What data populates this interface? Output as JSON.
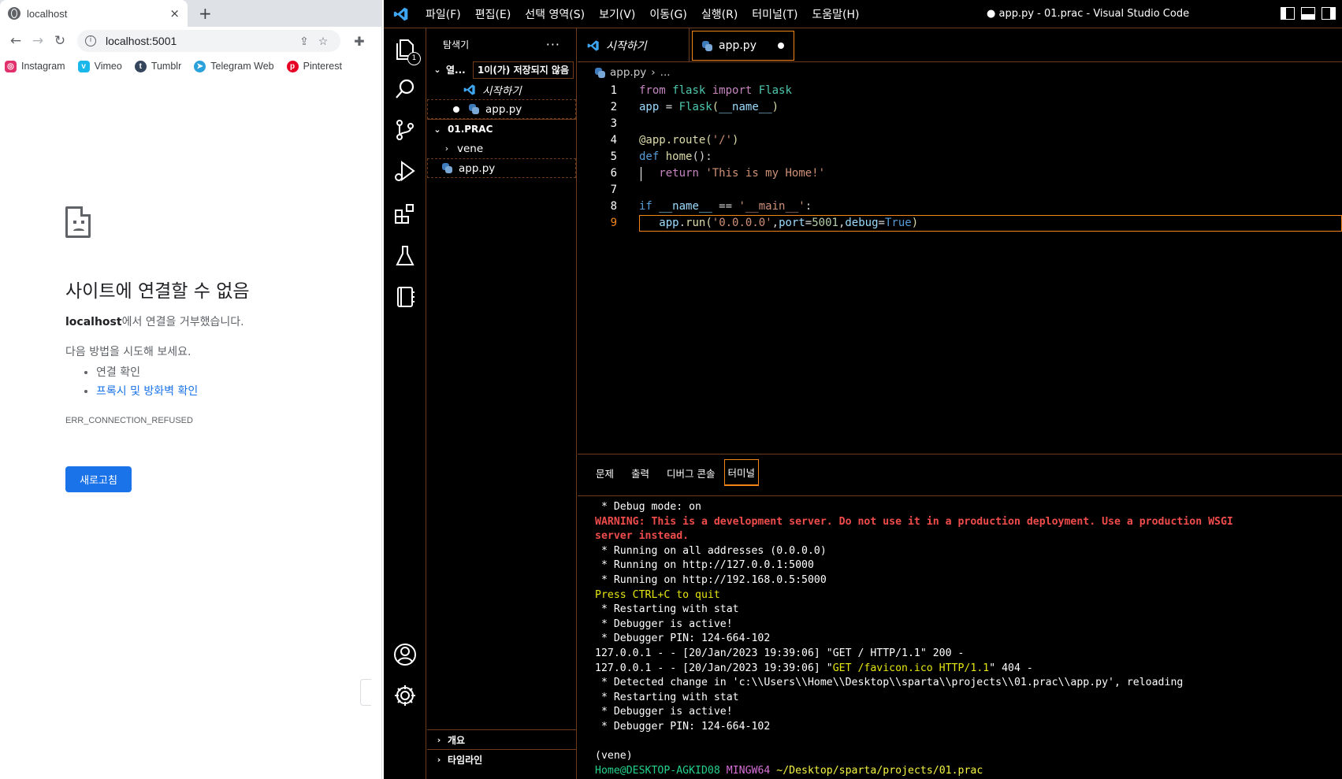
{
  "chrome": {
    "tab": {
      "title": "localhost",
      "close": "×"
    },
    "new_tab": "+",
    "omnibox": {
      "url": "localhost:5001"
    },
    "bookmarks": [
      {
        "label": "Instagram",
        "icon": "instagram-icon",
        "color": "#e1306c"
      },
      {
        "label": "Vimeo",
        "icon": "vimeo-icon",
        "color": "#1ab7ea"
      },
      {
        "label": "Tumblr",
        "icon": "tumblr-icon",
        "color": "#35465c"
      },
      {
        "label": "Telegram Web",
        "icon": "telegram-icon",
        "color": "#2aa1da"
      },
      {
        "label": "Pinterest",
        "icon": "pinterest-icon",
        "color": "#e60023"
      }
    ],
    "error": {
      "heading": "사이트에 연결할 수 없음",
      "host": "localhost",
      "message_suffix": "에서 연결을 거부했습니다.",
      "try_label": "다음 방법을 시도해 보세요.",
      "suggestion_1": "연결 확인",
      "suggestion_2": "프록시 및 방화벽 확인",
      "code": "ERR_CONNECTION_REFUSED",
      "reload_button": "새로고침"
    }
  },
  "vscode": {
    "menu": [
      "파일(F)",
      "편집(E)",
      "선택 영역(S)",
      "보기(V)",
      "이동(G)",
      "실행(R)",
      "터미널(T)",
      "도움말(H)"
    ],
    "window_title": "● app.py - 01.prac - Visual Studio Code",
    "explorer": {
      "title": "탐색기",
      "more": "···",
      "open_editors_label": "열...",
      "unsaved_badge": "1이(가) 저장되지 않음",
      "open_editors": [
        "시작하기",
        "app.py"
      ],
      "folder_label": "01.PRAC",
      "folder_items": [
        "vene",
        "app.py"
      ],
      "outline_label": "개요",
      "timeline_label": "타임라인"
    },
    "activity_badge": "1",
    "tabs": [
      {
        "label": "시작하기"
      },
      {
        "label": "app.py"
      }
    ],
    "breadcrumb": {
      "file": "app.py",
      "rest": "..."
    },
    "line_numbers": [
      "1",
      "2",
      "3",
      "4",
      "5",
      "6",
      "7",
      "8",
      "9"
    ],
    "code": {
      "l1_from": "from",
      "l1_mod": "flask",
      "l1_import": "import",
      "l1_cls": "Flask",
      "l2_var": "app",
      "l2_eq": " = ",
      "l2_cls": "Flask",
      "l2_open": "(",
      "l2_arg": "__name__",
      "l2_close": ")",
      "l4_dec": "@app.route",
      "l4_open": "(",
      "l4_str": "'/'",
      "l4_close": ")",
      "l5_def": "def",
      "l5_fn": "home",
      "l5_rest": "():",
      "l6_ret": "return",
      "l6_str": "'This is my Home!'",
      "l8_if": "if",
      "l8_var": "__name__",
      "l8_op": " == ",
      "l8_str": "'__main__'",
      "l8_colon": ":",
      "l9_obj": "app",
      "l9_dot": ".",
      "l9_fn": "run",
      "l9_open": "(",
      "l9_str": "'0.0.0.0'",
      "l9_c1": ",",
      "l9_port": "port",
      "l9_eq1": "=",
      "l9_num": "5001",
      "l9_c2": ",",
      "l9_dbg": "debug",
      "l9_eq2": "=",
      "l9_true": "True",
      "l9_close": ")"
    },
    "panel_tabs": [
      "문제",
      "출력",
      "디버그 콘솔",
      "터미널"
    ],
    "terminal": {
      "lines": [
        " * Debug mode: on",
        "WARNING: This is a development server. Do not use it in a production deployment. Use a production WSGI",
        "server instead.",
        " * Running on all addresses (0.0.0.0)",
        " * Running on http://127.0.0.1:5000",
        " * Running on http://192.168.0.5:5000",
        "Press CTRL+C to quit",
        " * Restarting with stat",
        " * Debugger is active!",
        " * Debugger PIN: 124-664-102",
        "127.0.0.1 - - [20/Jan/2023 19:39:06] \"GET / HTTP/1.1\" 200 -",
        "",
        " * Detected change in 'c:\\\\Users\\\\Home\\\\Desktop\\\\sparta\\\\projects\\\\01.prac\\\\app.py', reloading",
        " * Restarting with stat",
        " * Debugger is active!",
        " * Debugger PIN: 124-664-102",
        "",
        "(vene)"
      ],
      "favicon_prefix": "127.0.0.1 - - [20/Jan/2023 19:39:06] \"",
      "favicon_req": "GET /favicon.ico HTTP/1.1",
      "favicon_suffix": "\" 404 -",
      "prompt_user": "Home@DESKTOP-AGKID08",
      "prompt_env": "MINGW64",
      "prompt_path": "~/Desktop/sparta/projects/01.prac"
    }
  }
}
